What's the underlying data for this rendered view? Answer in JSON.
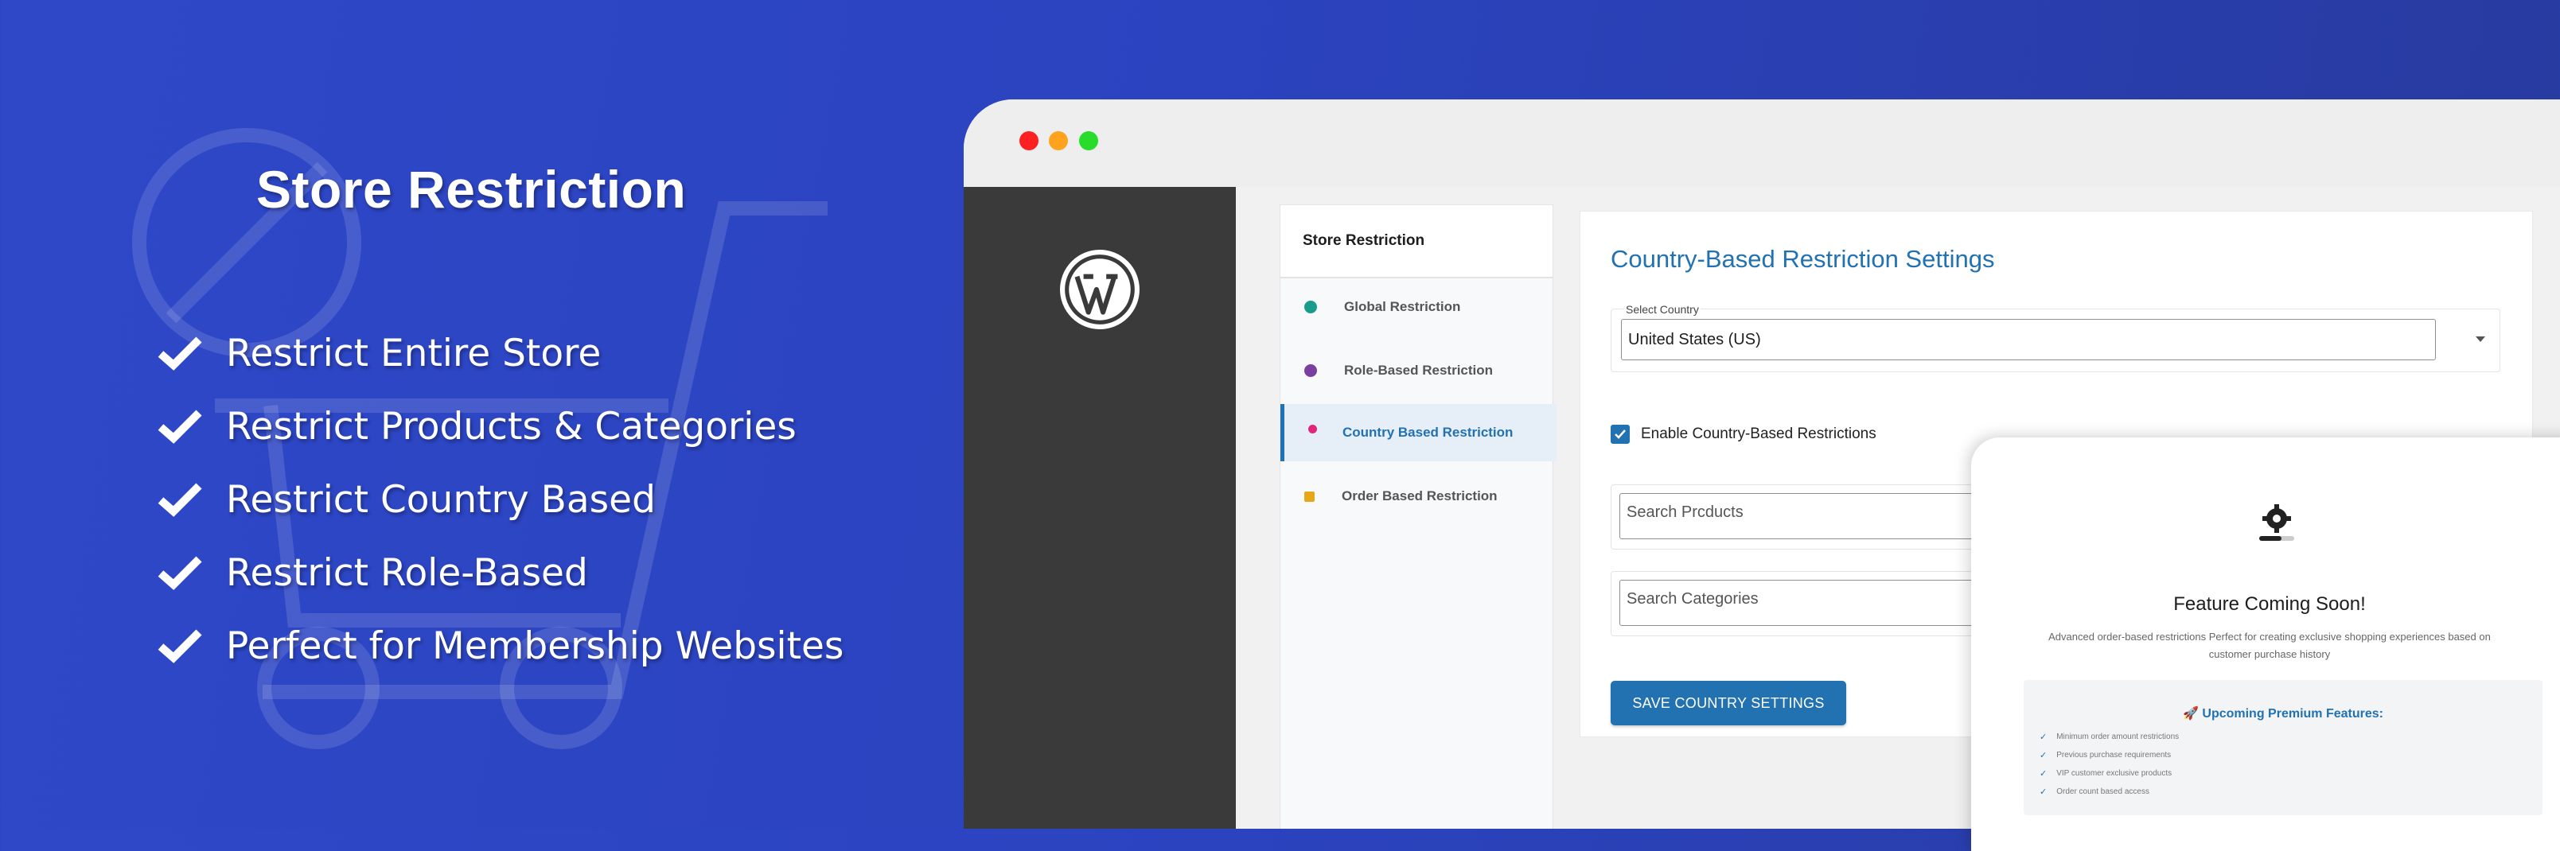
{
  "hero": {
    "title": "Store Restriction",
    "features": [
      "Restrict Entire Store",
      "Restrict Products & Categories",
      "Restrict Country Based",
      "Restrict Role-Based",
      "Perfect for Membership Websites"
    ]
  },
  "colors": {
    "background": "#2e48c8",
    "accent": "#2271b1",
    "wp_sidebar": "#3a3a3a",
    "traffic_red": "#ff2121",
    "traffic_yellow": "#ffa21d",
    "traffic_green": "#27dc2b"
  },
  "plugin_nav": {
    "title": "Store Restriction",
    "items": [
      {
        "label": "Global Restriction",
        "icon": "globe-icon",
        "color": "#1a9c8c",
        "active": false
      },
      {
        "label": "Role-Based Restriction",
        "icon": "users-icon",
        "color": "#7b3fa0",
        "active": false
      },
      {
        "label": "Country Based Restriction",
        "icon": "location-pin-icon",
        "color": "#e0267a",
        "active": true
      },
      {
        "label": "Order Based Restriction",
        "icon": "lock-icon",
        "color": "#e6a817",
        "active": false
      }
    ]
  },
  "settings": {
    "title": "Country-Based Restriction Settings",
    "select_caption": "Select Country",
    "selected_country": "United States (US)",
    "enable_label": "Enable Country-Based Restrictions",
    "enable_checked": true,
    "search_products_placeholder": "Search Prcducts",
    "search_categories_placeholder": "Search Categories",
    "save_label": "SAVE COUNTRY SETTINGS"
  },
  "popup": {
    "title": "Feature Coming Soon!",
    "description": "Advanced order-based restrictions Perfect for creating exclusive shopping experiences based on customer purchase history",
    "premium_title": "🚀 Upcoming Premium Features:",
    "premium_items": [
      "Minimum order amount restrictions",
      "Previous purchase requirements",
      "VIP customer exclusive products",
      "Order count based access"
    ]
  }
}
